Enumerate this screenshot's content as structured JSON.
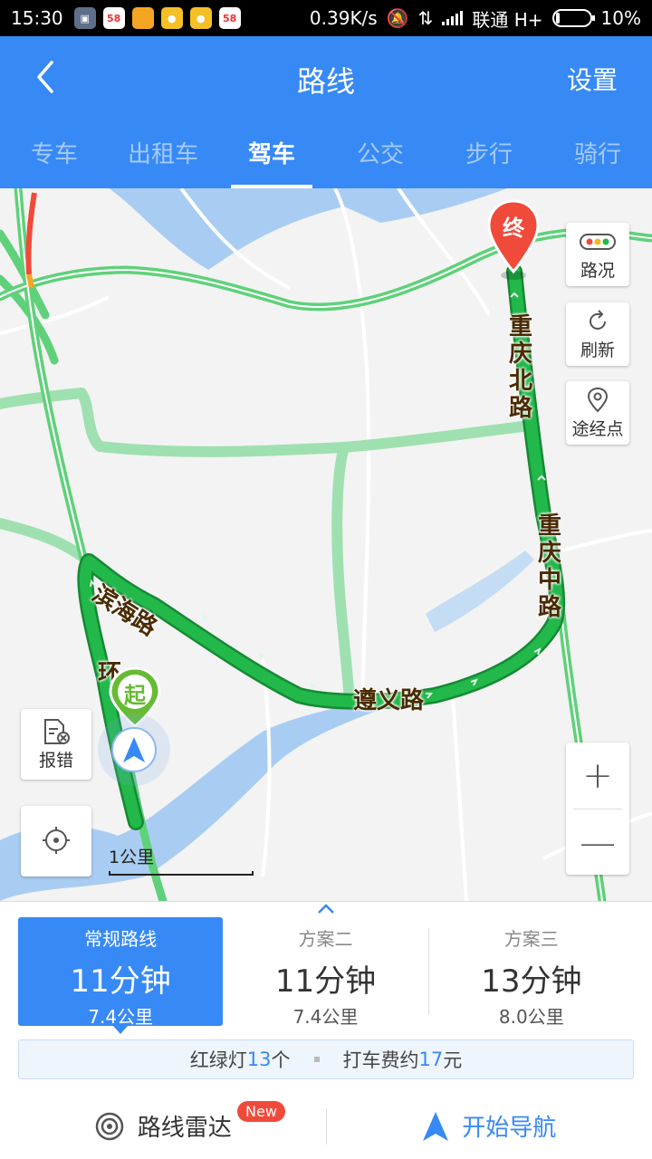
{
  "status_bar": {
    "time": "15:30",
    "network_speed": "0.39K/s",
    "carrier": "联通 H+",
    "battery": "10%",
    "app_icons": [
      {
        "name": "sim-icon",
        "label": "",
        "color": "#5f6f8a"
      },
      {
        "name": "app-58-icon",
        "label": "58",
        "color": "#ffffff"
      },
      {
        "name": "note-app-icon",
        "label": "",
        "color": "#f4a623"
      },
      {
        "name": "map-app-icon",
        "label": "",
        "color": "#f5c026"
      },
      {
        "name": "map-app-icon-2",
        "label": "",
        "color": "#f5c026"
      },
      {
        "name": "app-58-icon-2",
        "label": "58",
        "color": "#ffffff"
      }
    ]
  },
  "header": {
    "title": "路线",
    "settings_label": "设置",
    "tabs": [
      {
        "label": "专车",
        "active": false
      },
      {
        "label": "出租车",
        "active": false
      },
      {
        "label": "驾车",
        "active": true
      },
      {
        "label": "公交",
        "active": false
      },
      {
        "label": "步行",
        "active": false
      },
      {
        "label": "骑行",
        "active": false
      }
    ]
  },
  "map": {
    "road_labels": {
      "chongqing_north": "重庆北路",
      "chongqing_middle": "重庆中路",
      "binhai": "滨海路",
      "zunyi": "遵义路",
      "huan": "环"
    },
    "end_marker": "终",
    "start_marker": "起",
    "buttons": {
      "traffic": "路况",
      "refresh": "刷新",
      "waypoint": "途经点",
      "report": "报错"
    },
    "scale_label": "1公里",
    "route_color": "#22b84a"
  },
  "panel": {
    "plans": [
      {
        "name": "常规路线",
        "time": "11分钟",
        "distance": "7.4公里",
        "active": true
      },
      {
        "name": "方案二",
        "time": "11分钟",
        "distance": "7.4公里",
        "active": false
      },
      {
        "name": "方案三",
        "time": "13分钟",
        "distance": "8.0公里",
        "active": false
      }
    ],
    "info": {
      "lights_prefix": "红绿灯",
      "lights_count": "13",
      "lights_suffix": "个",
      "fare_prefix": "打车费约",
      "fare_amount": "17",
      "fare_suffix": "元"
    },
    "actions": {
      "radar_label": "路线雷达",
      "new_badge": "New",
      "navigate_label": "开始导航"
    }
  },
  "colors": {
    "primary": "#3789f6",
    "route_green": "#22b84a",
    "end_pin": "#f04a3a",
    "start_pin": "#66bb33"
  }
}
